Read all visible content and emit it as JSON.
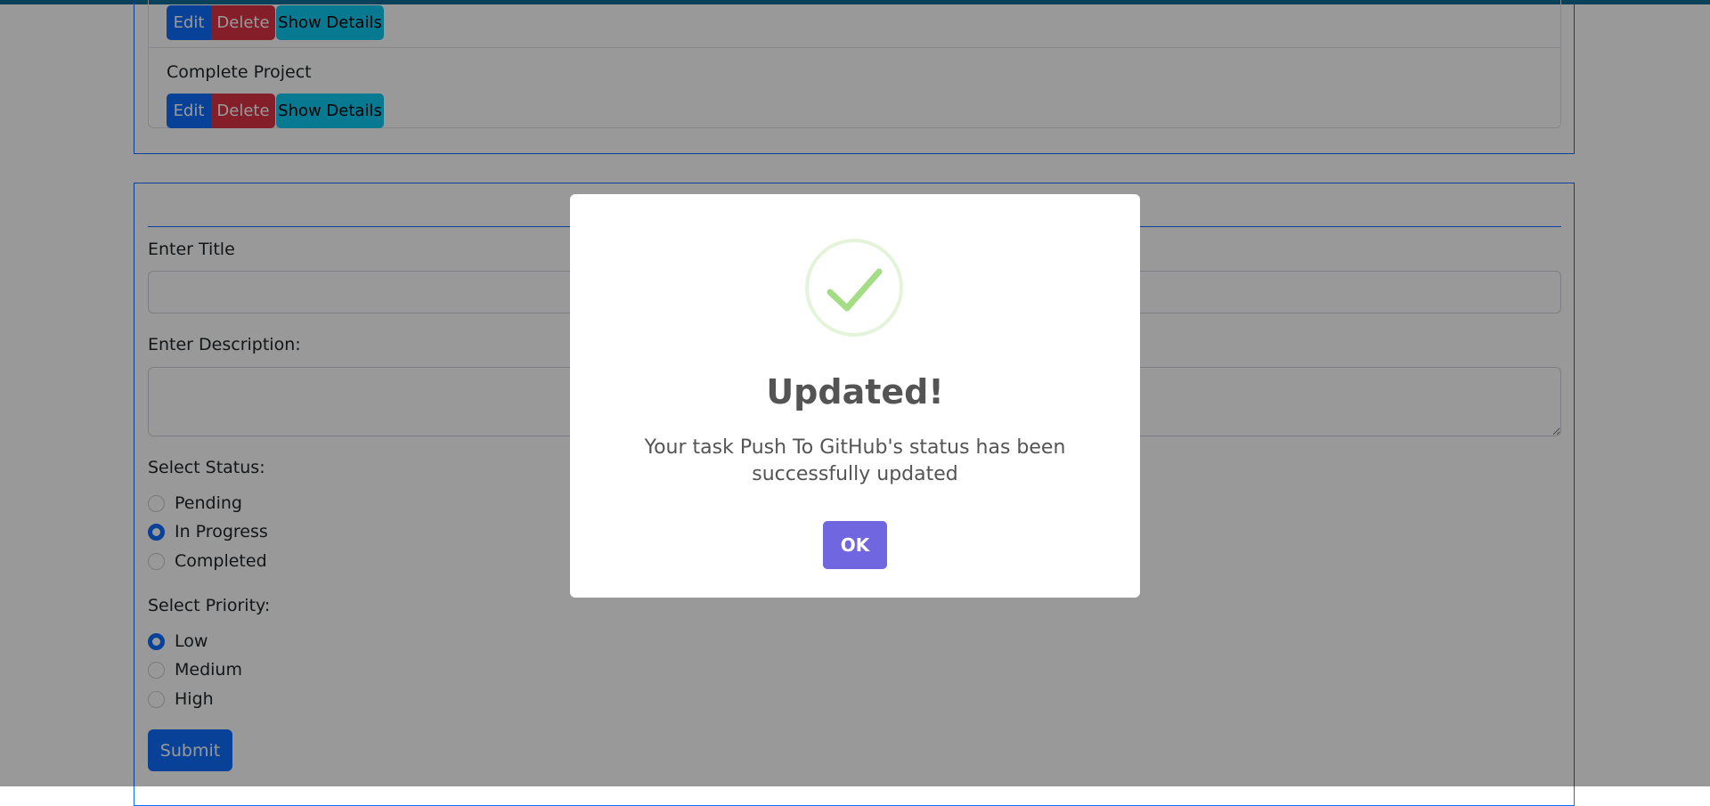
{
  "tasks": [
    {
      "title": "",
      "edit_label": "Edit",
      "delete_label": "Delete",
      "details_label": "Show Details"
    },
    {
      "title": "Complete Project",
      "edit_label": "Edit",
      "delete_label": "Delete",
      "details_label": "Show Details"
    }
  ],
  "form": {
    "title_label": "Enter Title",
    "title_value": "",
    "description_label": "Enter Description:",
    "description_value": "",
    "status_label": "Select Status:",
    "status_options": [
      "Pending",
      "In Progress",
      "Completed"
    ],
    "status_selected": "In Progress",
    "priority_label": "Select Priority:",
    "priority_options": [
      "Low",
      "Medium",
      "High"
    ],
    "priority_selected": "Low",
    "submit_label": "Submit"
  },
  "modal": {
    "icon": "success-check-icon",
    "title": "Updated!",
    "message": "Your task Push To GitHub's status has been successfully updated",
    "ok_label": "OK"
  },
  "colors": {
    "primary": "#0d6efd",
    "danger": "#dc3545",
    "info": "#0dcaf0",
    "confirm": "#7066e0",
    "success_check": "#a5dc86"
  }
}
